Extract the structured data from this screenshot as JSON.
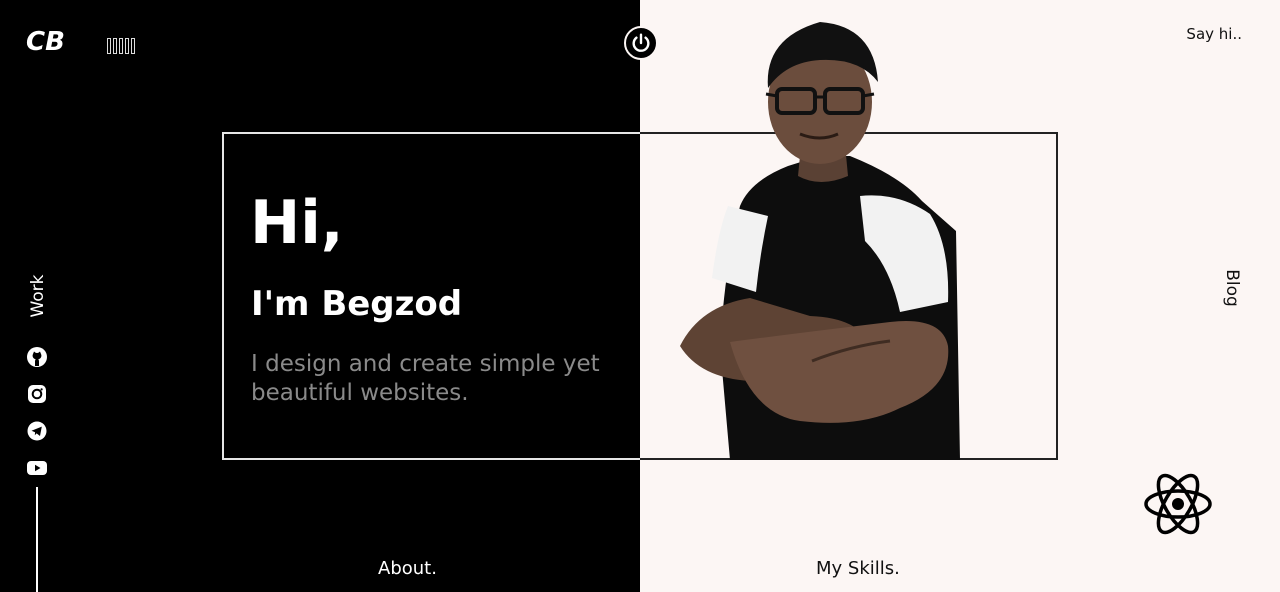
{
  "header": {
    "logo_text": "CB",
    "say_hi": "Say hi.."
  },
  "nav": {
    "work": "Work",
    "blog": "Blog",
    "about": "About.",
    "skills": "My Skills."
  },
  "hero": {
    "greeting": "Hi,",
    "name": "I'm Begzod",
    "tagline": "I design and create simple yet beautiful websites."
  },
  "social": [
    "github-icon",
    "instagram-icon",
    "telegram-icon",
    "youtube-icon"
  ],
  "colors": {
    "dark": "#000000",
    "light": "#fcf6f4",
    "muted_text": "#8a8a8a"
  }
}
